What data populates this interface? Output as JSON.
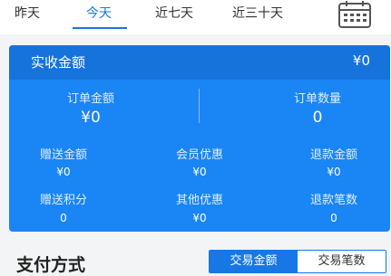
{
  "tabs": [
    {
      "label": "昨天",
      "active": false
    },
    {
      "label": "今天",
      "active": true
    },
    {
      "label": "近七天",
      "active": false
    },
    {
      "label": "近三十天",
      "active": false
    }
  ],
  "calendar_icon": "calendar-icon",
  "summary": {
    "title": "实收金额",
    "value": "¥0",
    "order_amount": {
      "label": "订单金额",
      "value": "¥0"
    },
    "order_count": {
      "label": "订单数量",
      "value": "0"
    },
    "stats_row1": [
      {
        "label": "赠送金额",
        "value": "¥0"
      },
      {
        "label": "会员优惠",
        "value": "¥0"
      },
      {
        "label": "退款金额",
        "value": "¥0"
      }
    ],
    "stats_row2": [
      {
        "label": "赠送积分",
        "value": "0"
      },
      {
        "label": "其他优惠",
        "value": "¥0"
      },
      {
        "label": "退款笔数",
        "value": "0"
      }
    ]
  },
  "payment": {
    "title": "支付方式",
    "toggle": [
      {
        "label": "交易金额",
        "active": true
      },
      {
        "label": "交易笔数",
        "active": false
      }
    ]
  },
  "colors": {
    "accent": "#1677e5",
    "card": "#1a86f5",
    "card_header": "#1673dc"
  }
}
